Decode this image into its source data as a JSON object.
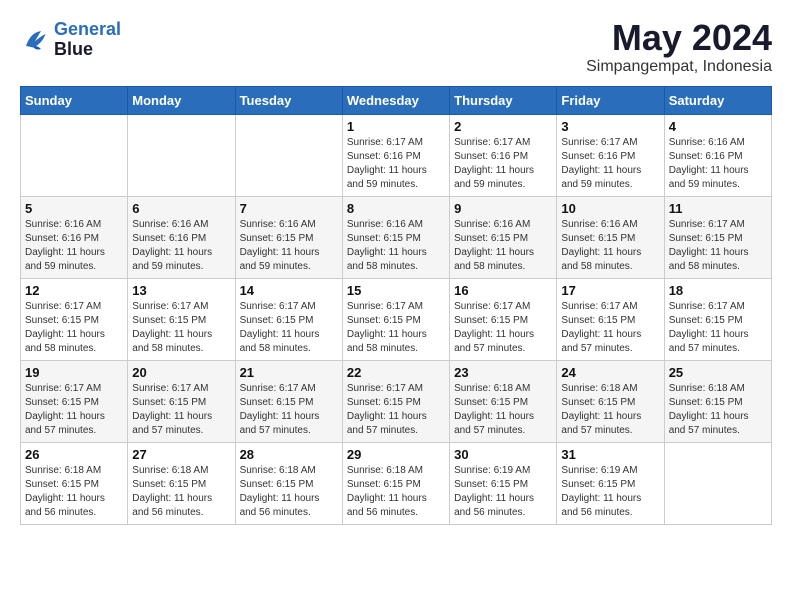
{
  "logo": {
    "line1": "General",
    "line2": "Blue"
  },
  "title": "May 2024",
  "location": "Simpangempat, Indonesia",
  "weekdays": [
    "Sunday",
    "Monday",
    "Tuesday",
    "Wednesday",
    "Thursday",
    "Friday",
    "Saturday"
  ],
  "weeks": [
    [
      {
        "day": "",
        "sunrise": "",
        "sunset": "",
        "daylight": ""
      },
      {
        "day": "",
        "sunrise": "",
        "sunset": "",
        "daylight": ""
      },
      {
        "day": "",
        "sunrise": "",
        "sunset": "",
        "daylight": ""
      },
      {
        "day": "1",
        "sunrise": "Sunrise: 6:17 AM",
        "sunset": "Sunset: 6:16 PM",
        "daylight": "Daylight: 11 hours and 59 minutes."
      },
      {
        "day": "2",
        "sunrise": "Sunrise: 6:17 AM",
        "sunset": "Sunset: 6:16 PM",
        "daylight": "Daylight: 11 hours and 59 minutes."
      },
      {
        "day": "3",
        "sunrise": "Sunrise: 6:17 AM",
        "sunset": "Sunset: 6:16 PM",
        "daylight": "Daylight: 11 hours and 59 minutes."
      },
      {
        "day": "4",
        "sunrise": "Sunrise: 6:16 AM",
        "sunset": "Sunset: 6:16 PM",
        "daylight": "Daylight: 11 hours and 59 minutes."
      }
    ],
    [
      {
        "day": "5",
        "sunrise": "Sunrise: 6:16 AM",
        "sunset": "Sunset: 6:16 PM",
        "daylight": "Daylight: 11 hours and 59 minutes."
      },
      {
        "day": "6",
        "sunrise": "Sunrise: 6:16 AM",
        "sunset": "Sunset: 6:16 PM",
        "daylight": "Daylight: 11 hours and 59 minutes."
      },
      {
        "day": "7",
        "sunrise": "Sunrise: 6:16 AM",
        "sunset": "Sunset: 6:15 PM",
        "daylight": "Daylight: 11 hours and 59 minutes."
      },
      {
        "day": "8",
        "sunrise": "Sunrise: 6:16 AM",
        "sunset": "Sunset: 6:15 PM",
        "daylight": "Daylight: 11 hours and 58 minutes."
      },
      {
        "day": "9",
        "sunrise": "Sunrise: 6:16 AM",
        "sunset": "Sunset: 6:15 PM",
        "daylight": "Daylight: 11 hours and 58 minutes."
      },
      {
        "day": "10",
        "sunrise": "Sunrise: 6:16 AM",
        "sunset": "Sunset: 6:15 PM",
        "daylight": "Daylight: 11 hours and 58 minutes."
      },
      {
        "day": "11",
        "sunrise": "Sunrise: 6:17 AM",
        "sunset": "Sunset: 6:15 PM",
        "daylight": "Daylight: 11 hours and 58 minutes."
      }
    ],
    [
      {
        "day": "12",
        "sunrise": "Sunrise: 6:17 AM",
        "sunset": "Sunset: 6:15 PM",
        "daylight": "Daylight: 11 hours and 58 minutes."
      },
      {
        "day": "13",
        "sunrise": "Sunrise: 6:17 AM",
        "sunset": "Sunset: 6:15 PM",
        "daylight": "Daylight: 11 hours and 58 minutes."
      },
      {
        "day": "14",
        "sunrise": "Sunrise: 6:17 AM",
        "sunset": "Sunset: 6:15 PM",
        "daylight": "Daylight: 11 hours and 58 minutes."
      },
      {
        "day": "15",
        "sunrise": "Sunrise: 6:17 AM",
        "sunset": "Sunset: 6:15 PM",
        "daylight": "Daylight: 11 hours and 58 minutes."
      },
      {
        "day": "16",
        "sunrise": "Sunrise: 6:17 AM",
        "sunset": "Sunset: 6:15 PM",
        "daylight": "Daylight: 11 hours and 57 minutes."
      },
      {
        "day": "17",
        "sunrise": "Sunrise: 6:17 AM",
        "sunset": "Sunset: 6:15 PM",
        "daylight": "Daylight: 11 hours and 57 minutes."
      },
      {
        "day": "18",
        "sunrise": "Sunrise: 6:17 AM",
        "sunset": "Sunset: 6:15 PM",
        "daylight": "Daylight: 11 hours and 57 minutes."
      }
    ],
    [
      {
        "day": "19",
        "sunrise": "Sunrise: 6:17 AM",
        "sunset": "Sunset: 6:15 PM",
        "daylight": "Daylight: 11 hours and 57 minutes."
      },
      {
        "day": "20",
        "sunrise": "Sunrise: 6:17 AM",
        "sunset": "Sunset: 6:15 PM",
        "daylight": "Daylight: 11 hours and 57 minutes."
      },
      {
        "day": "21",
        "sunrise": "Sunrise: 6:17 AM",
        "sunset": "Sunset: 6:15 PM",
        "daylight": "Daylight: 11 hours and 57 minutes."
      },
      {
        "day": "22",
        "sunrise": "Sunrise: 6:17 AM",
        "sunset": "Sunset: 6:15 PM",
        "daylight": "Daylight: 11 hours and 57 minutes."
      },
      {
        "day": "23",
        "sunrise": "Sunrise: 6:18 AM",
        "sunset": "Sunset: 6:15 PM",
        "daylight": "Daylight: 11 hours and 57 minutes."
      },
      {
        "day": "24",
        "sunrise": "Sunrise: 6:18 AM",
        "sunset": "Sunset: 6:15 PM",
        "daylight": "Daylight: 11 hours and 57 minutes."
      },
      {
        "day": "25",
        "sunrise": "Sunrise: 6:18 AM",
        "sunset": "Sunset: 6:15 PM",
        "daylight": "Daylight: 11 hours and 57 minutes."
      }
    ],
    [
      {
        "day": "26",
        "sunrise": "Sunrise: 6:18 AM",
        "sunset": "Sunset: 6:15 PM",
        "daylight": "Daylight: 11 hours and 56 minutes."
      },
      {
        "day": "27",
        "sunrise": "Sunrise: 6:18 AM",
        "sunset": "Sunset: 6:15 PM",
        "daylight": "Daylight: 11 hours and 56 minutes."
      },
      {
        "day": "28",
        "sunrise": "Sunrise: 6:18 AM",
        "sunset": "Sunset: 6:15 PM",
        "daylight": "Daylight: 11 hours and 56 minutes."
      },
      {
        "day": "29",
        "sunrise": "Sunrise: 6:18 AM",
        "sunset": "Sunset: 6:15 PM",
        "daylight": "Daylight: 11 hours and 56 minutes."
      },
      {
        "day": "30",
        "sunrise": "Sunrise: 6:19 AM",
        "sunset": "Sunset: 6:15 PM",
        "daylight": "Daylight: 11 hours and 56 minutes."
      },
      {
        "day": "31",
        "sunrise": "Sunrise: 6:19 AM",
        "sunset": "Sunset: 6:15 PM",
        "daylight": "Daylight: 11 hours and 56 minutes."
      },
      {
        "day": "",
        "sunrise": "",
        "sunset": "",
        "daylight": ""
      }
    ]
  ]
}
